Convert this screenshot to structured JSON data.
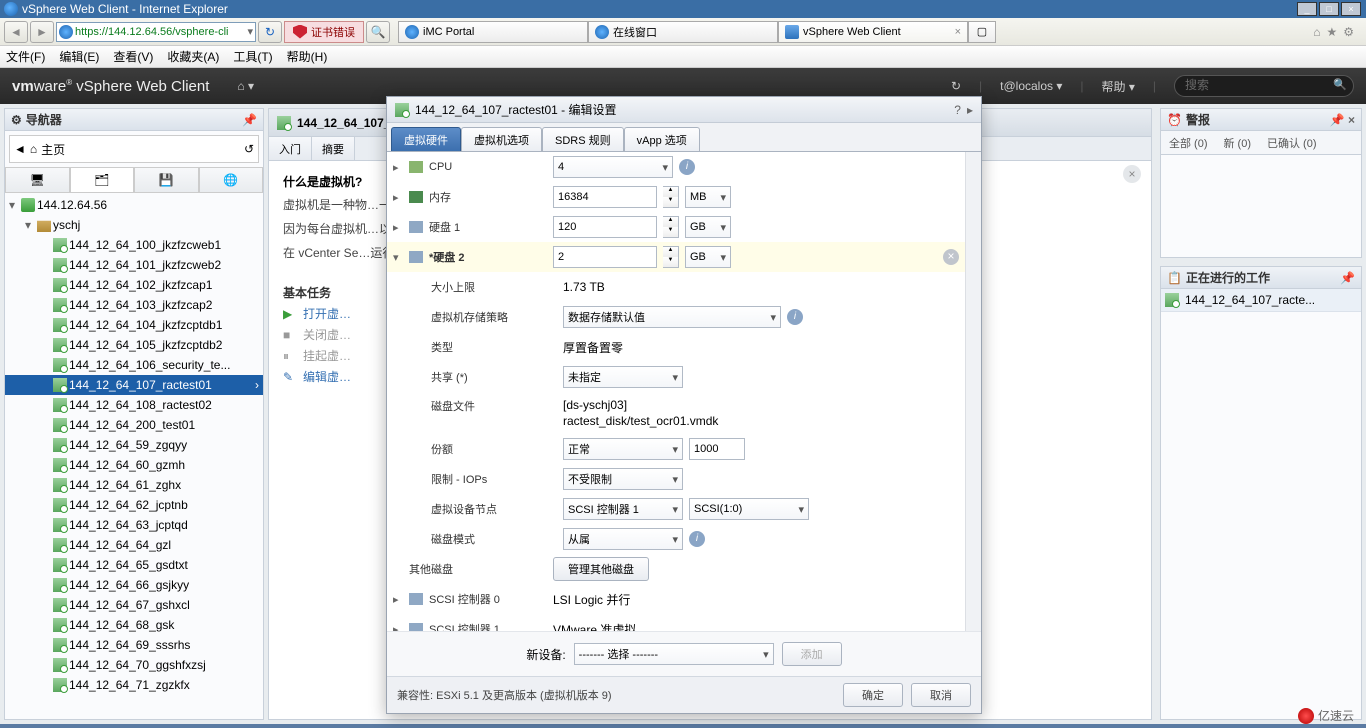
{
  "window": {
    "title": "vSphere Web Client - Internet Explorer"
  },
  "browser": {
    "url": "https://144.12.64.56/vsphere-cli",
    "cert_error": "证书错误",
    "tabs": [
      {
        "label": "iMC Portal",
        "icon": "ie"
      },
      {
        "label": "在线窗口",
        "icon": "ie"
      },
      {
        "label": "vSphere Web Client",
        "icon": "vm",
        "active": true
      }
    ],
    "menu": [
      "文件(F)",
      "编辑(E)",
      "查看(V)",
      "收藏夹(A)",
      "工具(T)",
      "帮助(H)"
    ]
  },
  "header": {
    "product": "vSphere Web Client",
    "user_suffix": "t@localos",
    "help": "帮助",
    "search_placeholder": "搜索"
  },
  "navigator": {
    "title": "导航器",
    "breadcrumb": "主页",
    "root": "144.12.64.56",
    "datacenter": "yschj",
    "vms": [
      "144_12_64_100_jkzfzcweb1",
      "144_12_64_101_jkzfzcweb2",
      "144_12_64_102_jkzfzcap1",
      "144_12_64_103_jkzfzcap2",
      "144_12_64_104_jkzfzcptdb1",
      "144_12_64_105_jkzfzcptdb2",
      "144_12_64_106_security_te...",
      "144_12_64_107_ractest01",
      "144_12_64_108_ractest02",
      "144_12_64_200_test01",
      "144_12_64_59_zgqyy",
      "144_12_64_60_gzmh",
      "144_12_64_61_zghx",
      "144_12_64_62_jcptnb",
      "144_12_64_63_jcptqd",
      "144_12_64_64_gzl",
      "144_12_64_65_gsdtxt",
      "144_12_64_66_gsjkyy",
      "144_12_64_67_gshxcl",
      "144_12_64_68_gsk",
      "144_12_64_69_sssrhs",
      "144_12_64_70_ggshfxzsj",
      "144_12_64_71_zgzkfx"
    ],
    "selected": "144_12_64_107_ractest01"
  },
  "center": {
    "title": "144_12_64_107_...",
    "tabs": [
      "入门",
      "摘要"
    ],
    "heading": "什么是虚拟机?",
    "p1": "虚拟机是一种物…一样运行操作系…的操作系统称为…",
    "p2": "因为每台虚拟机…以将虚拟机用作…或用来整合服务…",
    "p3": "在 vCenter Se…运行。同一台…",
    "tasks_header": "基本任务",
    "tasks": [
      {
        "icon": "play",
        "label": "打开虚…"
      },
      {
        "icon": "stop",
        "label": "关闭虚…"
      },
      {
        "icon": "pause",
        "label": "挂起虚…"
      },
      {
        "icon": "edit",
        "label": "编辑虚…"
      }
    ]
  },
  "alerts": {
    "title": "警报",
    "tabs": [
      {
        "label": "全部 (0)"
      },
      {
        "label": "新 (0)"
      },
      {
        "label": "已确认 (0)"
      }
    ]
  },
  "wip": {
    "title": "正在进行的工作",
    "item": "144_12_64_107_racte..."
  },
  "dialog": {
    "title": "144_12_64_107_ractest01 - 编辑设置",
    "tabs": [
      "虚拟硬件",
      "虚拟机选项",
      "SDRS 规则",
      "vApp 选项"
    ],
    "cpu_label": "CPU",
    "cpu_value": "4",
    "mem_label": "内存",
    "mem_value": "16384",
    "mem_unit": "MB",
    "disk1_label": "硬盘 1",
    "disk1_value": "120",
    "disk1_unit": "GB",
    "disk2_label": "*硬盘 2",
    "disk2_value": "2",
    "disk2_unit": "GB",
    "maxsize_label": "大小上限",
    "maxsize_value": "1.73 TB",
    "policy_label": "虚拟机存储策略",
    "policy_value": "数据存储默认值",
    "type_label": "类型",
    "type_value": "厚置备置零",
    "share_label": "共享 (*)",
    "share_value": "未指定",
    "file_label": "磁盘文件",
    "file_line1": "[ds-yschj03]",
    "file_line2": "ractest_disk/test_ocr01.vmdk",
    "shares2_label": "份额",
    "shares2_value": "正常",
    "shares2_num": "1000",
    "limit_label": "限制 - IOPs",
    "limit_value": "不受限制",
    "node_label": "虚拟设备节点",
    "node_ctrl": "SCSI 控制器 1",
    "node_slot": "SCSI(1:0)",
    "mode_label": "磁盘模式",
    "mode_value": "从属",
    "other_label": "其他磁盘",
    "other_btn": "管理其他磁盘",
    "scsi0_label": "SCSI 控制器 0",
    "scsi0_value": "LSI Logic 并行",
    "scsi1_label": "SCSI 控制器 1",
    "scsi1_value": "VMware 准虚拟",
    "newdev_label": "新设备:",
    "newdev_value": "------- 选择 -------",
    "add_btn": "添加",
    "compat": "兼容性: ESXi 5.1 及更高版本 (虚拟机版本 9)",
    "ok": "确定",
    "cancel": "取消"
  },
  "watermark": "亿速云"
}
